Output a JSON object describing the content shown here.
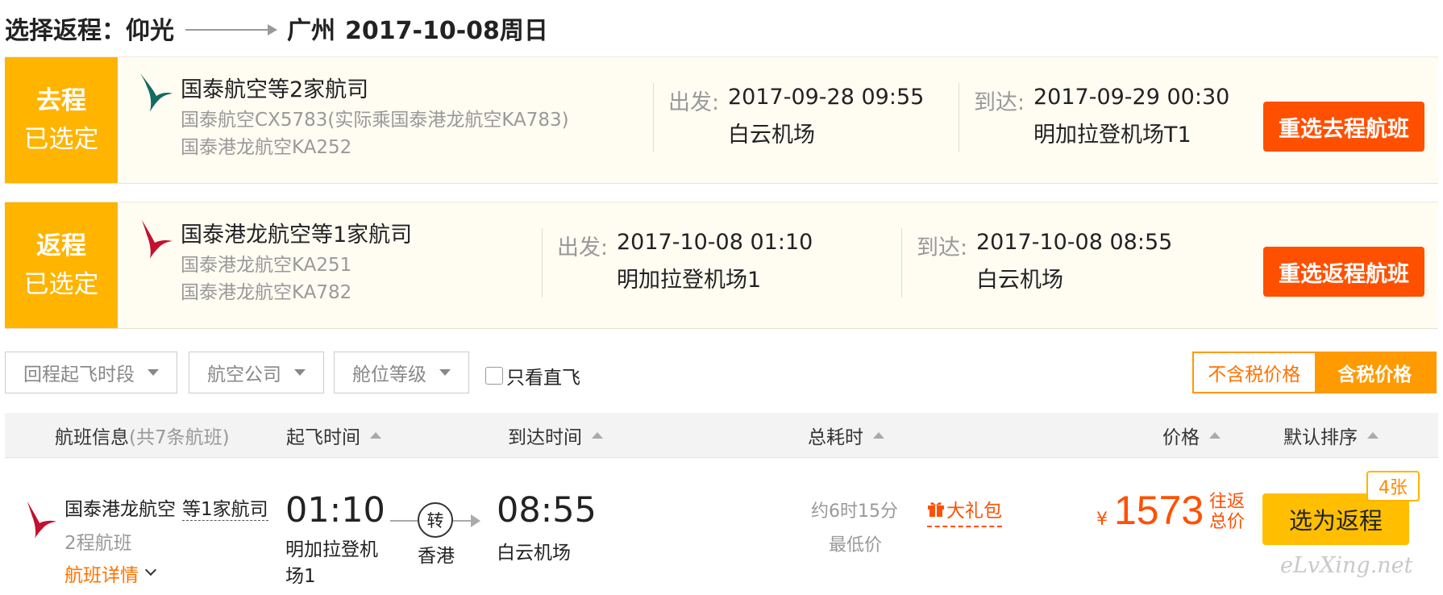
{
  "header": {
    "prefix": "选择返程：",
    "from": "仰光",
    "to": "广州",
    "date": "2017-10-08周日"
  },
  "outbound": {
    "badge_line1": "去程",
    "badge_line2": "已选定",
    "airline_summary": "国泰航空等2家航司",
    "flight_1": "国泰航空CX5783(实际乘国泰港龙航空KA783)",
    "flight_2": "国泰港龙航空KA252",
    "depart_label": "出发:",
    "depart_time": "2017-09-28 09:55",
    "depart_airport": "白云机场",
    "arrive_label": "到达:",
    "arrive_time": "2017-09-29 00:30",
    "arrive_airport": "明加拉登机场T1",
    "reselect_label": "重选去程航班"
  },
  "return": {
    "badge_line1": "返程",
    "badge_line2": "已选定",
    "airline_summary": "国泰港龙航空等1家航司",
    "flight_1": "国泰港龙航空KA251",
    "flight_2": "国泰港龙航空KA782",
    "depart_label": "出发:",
    "depart_time": "2017-10-08 01:10",
    "depart_airport": "明加拉登机场1",
    "arrive_label": "到达:",
    "arrive_time": "2017-10-08 08:55",
    "arrive_airport": "白云机场",
    "reselect_label": "重选返程航班"
  },
  "filters": {
    "time_period": "回程起飞时段",
    "airline": "航空公司",
    "cabin": "舱位等级",
    "direct_only": "只看直飞",
    "price_excl_tax": "不含税价格",
    "price_incl_tax": "含税价格"
  },
  "list_header": {
    "flight_info": "航班信息",
    "flight_count": "(共7条航班)",
    "depart_time": "起飞时间",
    "arrive_time": "到达时间",
    "duration": "总耗时",
    "price": "价格",
    "default_sort": "默认排序"
  },
  "flights": [
    {
      "airline": "国泰港龙航空",
      "more_airlines": "等1家航司",
      "legs": "2程航班",
      "details_link": "航班详情",
      "depart_time": "01:10",
      "depart_airport": "明加拉登机场1",
      "transfer_label": "转",
      "transfer_city": "香港",
      "arrive_time": "08:55",
      "arrive_airport": "白云机场",
      "duration": "约6时15分",
      "lowest_price_tag": "最低价",
      "gift": "大礼包",
      "currency": "¥",
      "price": "1573",
      "trip_type_line1": "往返",
      "trip_type_line2": "总价",
      "tickets_left": "4张",
      "select_label": "选为返程"
    }
  ],
  "watermark": "eLvXing.net",
  "colors": {
    "badge_yellow": "#ffb400",
    "reselect_orange": "#ff5000",
    "price_red": "#ff5000",
    "select_button": "#ffbf00",
    "toggle_orange": "#ff9a00",
    "card_bg": "#fffcf2"
  }
}
